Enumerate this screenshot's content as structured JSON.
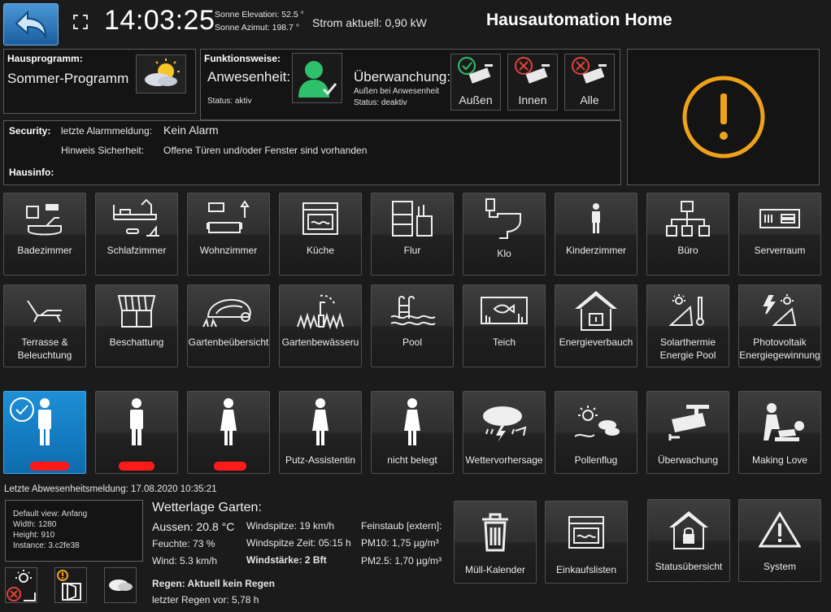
{
  "header": {
    "time": "14:03:25",
    "sun_elevation": "Sonne Elevation: 52.5 °",
    "sun_azimuth": "Sonne Azimut: 198.7 °",
    "power": "Strom aktuell: 0,90 kW",
    "title": "Hausautomation Home"
  },
  "hausprogramm": {
    "label": "Hausprogramm:",
    "value": "Sommer-Programm"
  },
  "funktion": {
    "label": "Funktionsweise:",
    "mode": "Anwesenheit:",
    "status": "Status: aktiv",
    "ueberwachung": "Überwanchung:",
    "ueber_sub": "Außen bei Anwesenheit",
    "ueber_status": "Status: deaktiv",
    "cams": [
      "Außen",
      "Innen",
      "Alle"
    ]
  },
  "security": {
    "label": "Security:",
    "alarm_label": "letzte Alarmmeldung:",
    "alarm_value": "Kein Alarm",
    "hint_label": "Hinweis Sicherheit:",
    "hint_value": "Offene Türen und/oder Fenster sind vorhanden",
    "hausinfo": "Hausinfo:"
  },
  "rooms_row1": [
    "Badezimmer",
    "Schlafzimmer",
    "Wohnzimmer",
    "Küche",
    "Flur",
    "Klo",
    "Kinderzimmer",
    "Büro",
    "Serverraum"
  ],
  "rooms_row2": [
    "Terrasse &\nBeleuchtung",
    "Beschattung",
    "Gartenbeübersicht",
    "Gartenbewässeru",
    "Pool",
    "Teich",
    "Energieverbauch",
    "Solarthermie\nEnergie Pool",
    "Photovoltaik\nEnergiegewinnung"
  ],
  "rooms_row3": [
    "",
    "",
    "",
    "Putz-Assistentin",
    "nicht belegt",
    "Wettervorhersage",
    "Pollenflug",
    "Überwachung",
    "Making Love"
  ],
  "absence": "Letzte Abwesenheitsmeldung:  17.08.2020 10:35:21",
  "info_box": [
    "Default view: Anfang",
    "Width: 1280",
    "Height: 910",
    "Instance: 3.c2fe38"
  ],
  "weather": {
    "title": "Wetterlage Garten:",
    "aussen": "Aussen: 20.8 °C",
    "feuchte": "Feuchte: 73 %",
    "wind": "Wind: 5.3 km/h",
    "windspitze": "Windspitze: 19 km/h",
    "windspitze_zeit": "Windspitze Zeit: 05:15 h",
    "windstaerke": "Windstärke: 2 Bft",
    "feinstaub": "Feinstaub [extern]:",
    "pm10": "PM10: 1,75 µg/m³",
    "pm25": "PM2.5: 1,70 µg/m³",
    "regen": "Regen: Aktuell kein Regen",
    "letzter_regen": "letzter Regen vor:   5,78 h"
  },
  "bottom_tiles": [
    "Müll-Kalender",
    "Einkaufslisten",
    "Statusübersicht",
    "System"
  ],
  "colors": {
    "accent": "#1b8ad0",
    "warning": "#f0a11a",
    "ok": "#2ec06a",
    "alarm": "#ff1a1a"
  }
}
